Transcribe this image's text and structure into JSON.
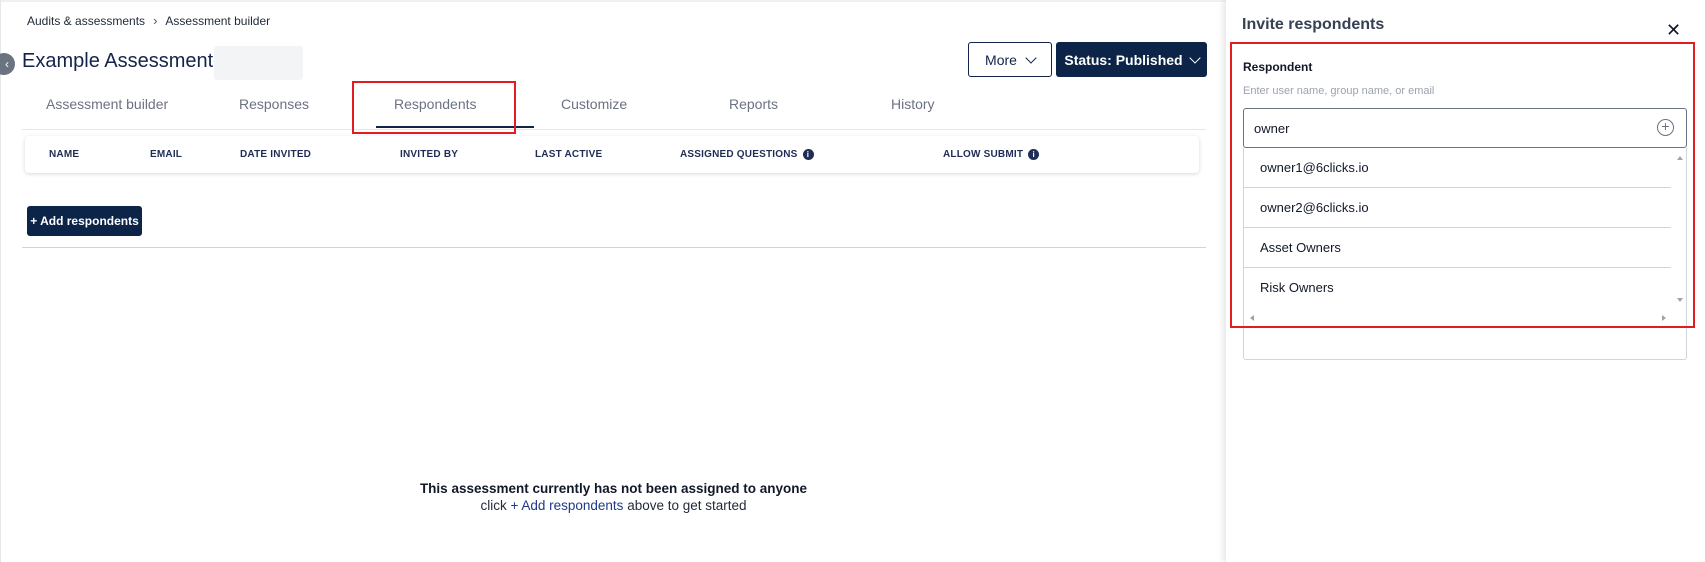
{
  "breadcrumb": [
    "Audits & assessments",
    "Assessment builder"
  ],
  "page": {
    "title": "Example Assessment"
  },
  "actions": {
    "more_label": "More",
    "status_label": "Status: Published"
  },
  "tabs": [
    "Assessment builder",
    "Responses",
    "Respondents",
    "Customize",
    "Reports",
    "History"
  ],
  "active_tab": "Respondents",
  "table": {
    "columns": [
      "NAME",
      "EMAIL",
      "DATE INVITED",
      "INVITED BY",
      "LAST ACTIVE",
      "ASSIGNED QUESTIONS",
      "ALLOW SUBMIT"
    ]
  },
  "add_button_label": "+ Add respondents",
  "empty_state": {
    "title": "This assessment currently has not been assigned to anyone",
    "pre": "click ",
    "link": "+ Add respondents",
    "post": " above to get started"
  },
  "panel": {
    "title": "Invite respondents",
    "field_label": "Respondent",
    "hint": "Enter user name, group name, or email",
    "input_value": "owner",
    "options": [
      "owner1@6clicks.io",
      "owner2@6clicks.io",
      "Asset Owners",
      "Risk Owners"
    ]
  },
  "colors": {
    "brand_navy": "#0b2447",
    "title_navy": "#14234b",
    "highlight_red": "#e11d24"
  }
}
